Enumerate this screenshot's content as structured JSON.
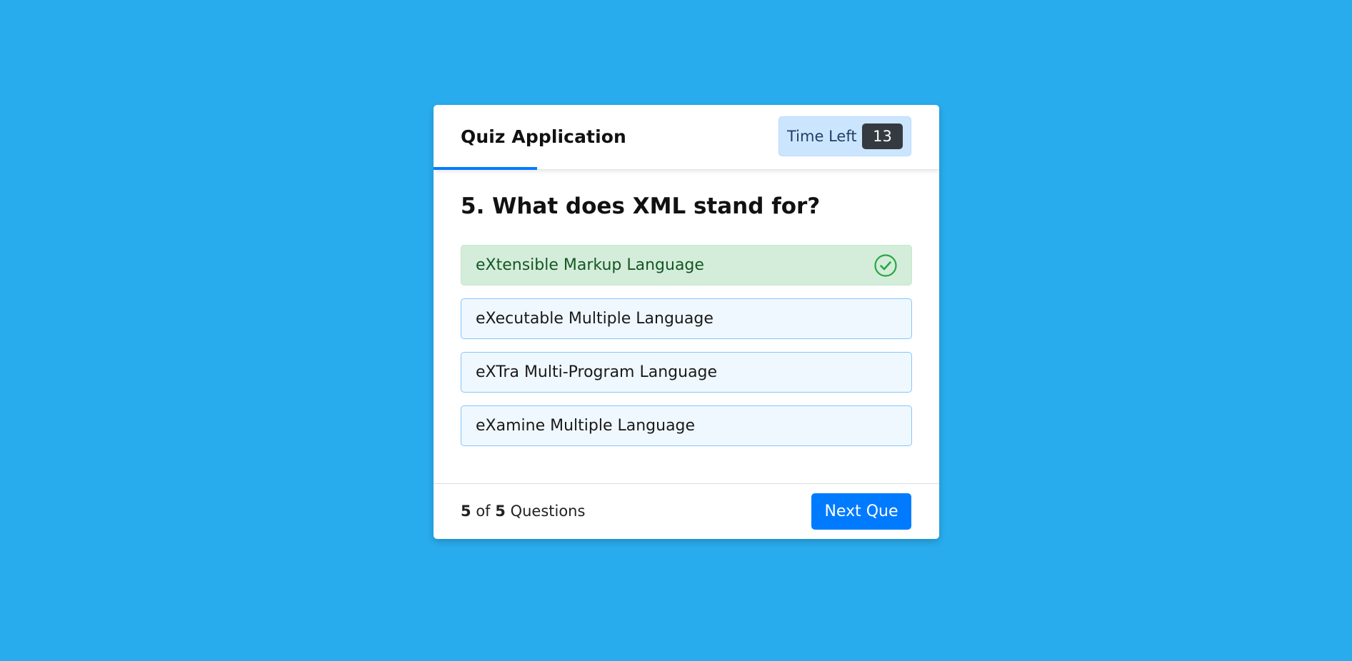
{
  "header": {
    "title": "Quiz Application",
    "timer_label": "Time Left",
    "timer_seconds": "13",
    "time_line_progress": 0.205
  },
  "question": {
    "text": "5. What does XML stand for?"
  },
  "options": [
    {
      "label": "eXtensible Markup Language",
      "state": "correct",
      "icon": "check-circle-icon"
    },
    {
      "label": "eXecutable Multiple Language",
      "state": "default"
    },
    {
      "label": "eXTra Multi-Program Language",
      "state": "default"
    },
    {
      "label": "eXamine Multiple Language",
      "state": "default"
    }
  ],
  "footer": {
    "current": "5",
    "of_text": "of",
    "total": "5",
    "questions_text": "Questions",
    "next_label": "Next Que"
  },
  "colors": {
    "background": "#29aced",
    "accent": "#007bff",
    "correct_bg": "#d4edda",
    "correct_text": "#155724",
    "correct_icon": "#28a745",
    "option_bg": "#f0f8ff",
    "option_border": "#84c5fe",
    "timer_bg": "#cce5ff",
    "timer_badge_bg": "#343a40"
  }
}
